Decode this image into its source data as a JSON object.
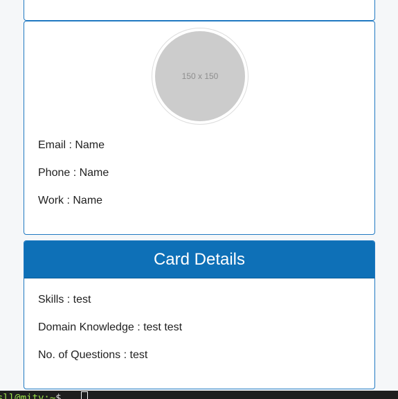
{
  "profile": {
    "avatar_placeholder": "150 x 150",
    "email": "Email : Name",
    "phone": "Phone : Name",
    "work": "Work : Name"
  },
  "details": {
    "title": "Card Details",
    "skills": "Skills : test",
    "domain_knowledge": "Domain Knowledge : test test",
    "num_questions": "No. of Questions : test"
  },
  "terminal": {
    "prompt": "sll@mity:~",
    "symbol": "$"
  },
  "colors": {
    "accent": "#0e70b7",
    "card_border": "#1f78c1",
    "page_background": "#f5f7f9",
    "avatar_fill": "#cccccc"
  }
}
